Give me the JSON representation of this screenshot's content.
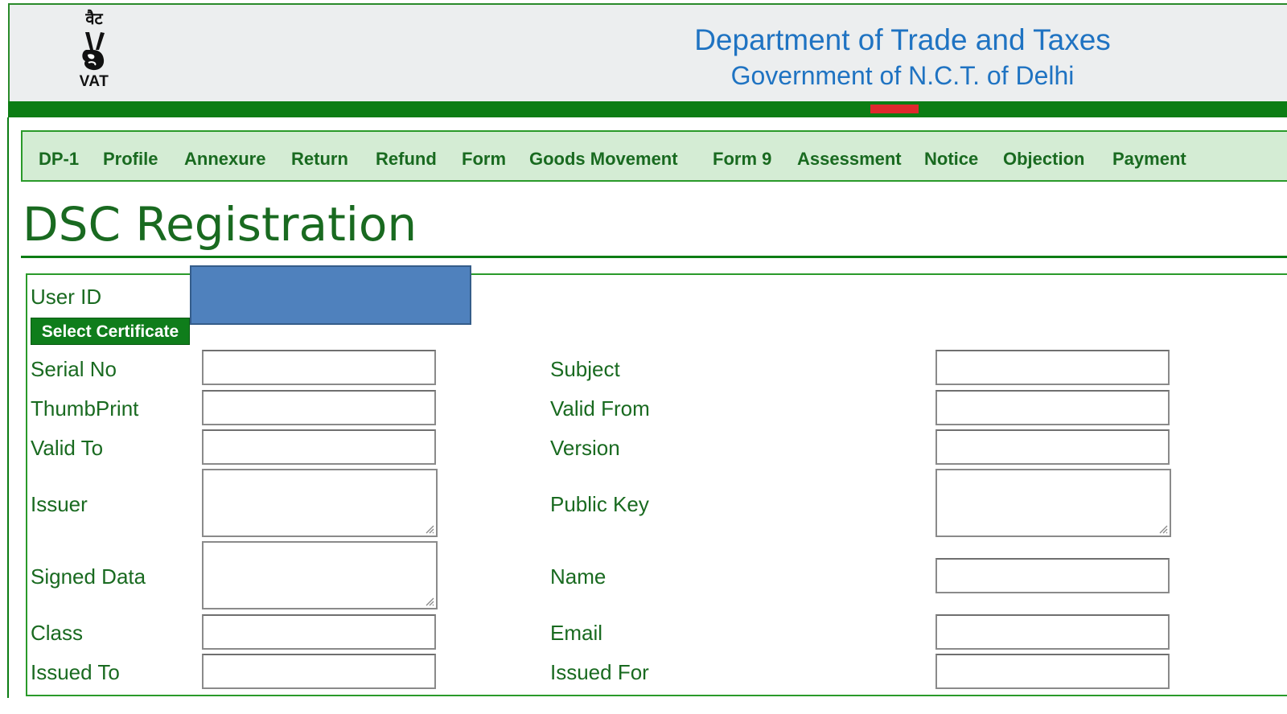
{
  "header": {
    "logo_top": "वैट",
    "logo_text": "VAT",
    "title": "Department of Trade and Taxes",
    "subtitle": "Government of N.C.T. of Delhi"
  },
  "nav": {
    "items": [
      "DP-1",
      "Profile",
      "Annexure",
      "Return",
      "Refund",
      "Form",
      "Goods Movement",
      "Form 9",
      "Assessment",
      "Notice",
      "Objection",
      "Payment"
    ]
  },
  "page": {
    "title": "DSC Registration"
  },
  "form": {
    "user_id_label": "User ID",
    "user_id_value": "",
    "select_certificate": "Select Certificate",
    "left_labels": {
      "serial_no": "Serial No",
      "thumbprint": "ThumbPrint",
      "valid_to": "Valid To",
      "issuer": "Issuer",
      "signed_data": "Signed Data",
      "class": "Class",
      "issued_to": "Issued To"
    },
    "right_labels": {
      "subject": "Subject",
      "valid_from": "Valid From",
      "version": "Version",
      "public_key": "Public Key",
      "name": "Name",
      "email": "Email",
      "issued_for": "Issued For"
    }
  },
  "colors": {
    "brand_green": "#0c7d14",
    "nav_bg": "#d4ecd4",
    "title_blue": "#1f73c2",
    "accent_red": "#e0282e",
    "redaction_blue": "#4f81bd"
  }
}
